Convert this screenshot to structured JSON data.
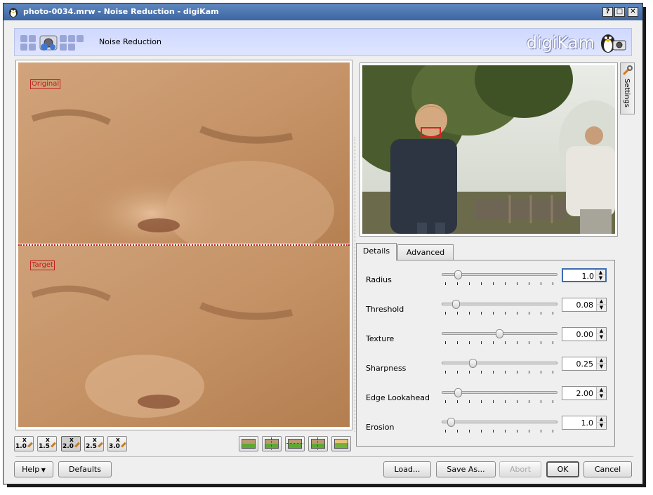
{
  "window": {
    "title": "photo-0034.mrw - Noise Reduction - digiKam",
    "help_btn": "?",
    "max_btn": "□",
    "close_btn": "✕"
  },
  "header": {
    "title": "Noise Reduction",
    "brand": "digiKam"
  },
  "preview": {
    "original_label": "Original",
    "target_label": "Target"
  },
  "zoom_buttons": [
    {
      "label": "1.0",
      "active": false
    },
    {
      "label": "1.5",
      "active": false
    },
    {
      "label": "2.0",
      "active": true
    },
    {
      "label": "2.5",
      "active": false
    },
    {
      "label": "3.0",
      "active": false
    }
  ],
  "side_tab": {
    "label": "Settings"
  },
  "tabs": [
    {
      "label": "Details",
      "active": true
    },
    {
      "label": "Advanced",
      "active": false
    }
  ],
  "params": [
    {
      "label": "Radius",
      "value": "1.0",
      "level": 0.12,
      "focused": true
    },
    {
      "label": "Threshold",
      "value": "0.08",
      "level": 0.1,
      "focused": false
    },
    {
      "label": "Texture",
      "value": "0.00",
      "level": 0.5,
      "focused": false
    },
    {
      "label": "Sharpness",
      "value": "0.25",
      "level": 0.25,
      "focused": false
    },
    {
      "label": "Edge Lookahead",
      "value": "2.00",
      "level": 0.12,
      "focused": false
    },
    {
      "label": "Erosion",
      "value": "1.0",
      "level": 0.05,
      "focused": false
    }
  ],
  "buttons": {
    "help": "Help",
    "defaults": "Defaults",
    "load": "Load...",
    "save_as": "Save As...",
    "abort": "Abort",
    "ok": "OK",
    "cancel": "Cancel"
  },
  "colors": {
    "title_bar": "#4a73ad",
    "header_bg": "#d6deff",
    "accent": "#3d6bb1",
    "preview_marker": "#c02020"
  }
}
